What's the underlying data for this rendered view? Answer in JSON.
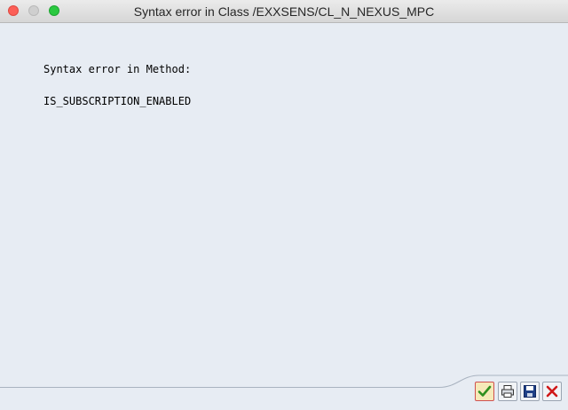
{
  "window": {
    "title": "Syntax error in Class /EXXSENS/CL_N_NEXUS_MPC"
  },
  "message": {
    "line1": "Syntax error in Method:",
    "line2": "IS_SUBSCRIPTION_ENABLED"
  },
  "toolbar": {
    "buttons": [
      {
        "icon": "checkmark-icon",
        "action": "continue"
      },
      {
        "icon": "printer-icon",
        "action": "print"
      },
      {
        "icon": "floppy-disk-icon",
        "action": "save"
      },
      {
        "icon": "close-x-icon",
        "action": "cancel"
      }
    ]
  },
  "colors": {
    "background": "#e7ecf3",
    "close": "#fc5f57",
    "minimize": "#cfcfcf",
    "maximize": "#2ac940",
    "check": "#2f8f1f",
    "cancel": "#d01818"
  }
}
